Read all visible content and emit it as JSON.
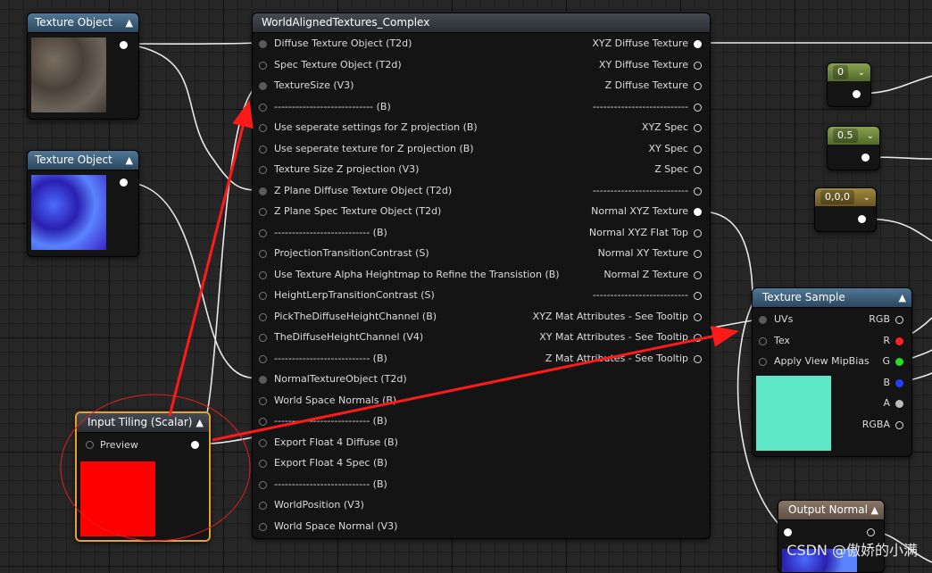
{
  "nodes": {
    "texture_object_1": {
      "title": "Texture Object"
    },
    "texture_object_2": {
      "title": "Texture Object"
    },
    "input_tiling": {
      "title": "Input Tiling (Scalar)",
      "pin": "Preview"
    },
    "world_aligned": {
      "title": "WorldAlignedTextures_Complex",
      "inputs": [
        "Diffuse Texture Object (T2d)",
        "Spec Texture Object (T2d)",
        "TextureSize (V3)",
        "---------------------------- (B)",
        "Use seperate settings for Z projection (B)",
        "Use seperate texture for Z projection (B)",
        "Texture Size Z projection (V3)",
        "Z Plane Diffuse Texture Object (T2d)",
        "Z Plane Spec Texture Object (T2d)",
        "---------------------------        (B)",
        "ProjectionTransitionContrast (S)",
        "Use Texture Alpha Heightmap to Refine the Transistion (B)",
        "HeightLerpTransitionContrast (S)",
        "PickTheDiffuseHeightChannel (B)",
        "TheDiffuseHeightChannel (V4)",
        "---------------------------        (B)",
        "NormalTextureObject (T2d)",
        "World Space Normals (B)",
        "---------------------------    (B)",
        "Export Float 4 Diffuse (B)",
        "Export Float 4 Spec (B)",
        "---------------------------        (B)",
        "WorldPosition (V3)",
        "World Space Normal (V3)"
      ],
      "outputs": [
        "XYZ Diffuse Texture",
        "XY Diffuse Texture",
        "Z Diffuse Texture",
        "---------------------------",
        "XYZ Spec",
        "XY Spec",
        "Z Spec",
        "---------------------------",
        "Normal XYZ Texture",
        "Normal XYZ Flat Top",
        "Normal XY Texture",
        "Normal Z Texture",
        "---------------------------",
        "XYZ Mat Attributes - See Tooltip",
        "XY Mat Attributes - See Tooltip",
        "Z Mat Attributes - See Tooltip"
      ]
    },
    "const_0": {
      "value": "0"
    },
    "const_05": {
      "value": "0.5"
    },
    "const_000": {
      "value": "0,0,0"
    },
    "texture_sample": {
      "title": "Texture Sample",
      "inputs": [
        "UVs",
        "Tex",
        "Apply View MipBias"
      ],
      "outputs": [
        "RGB",
        "R",
        "G",
        "B",
        "A",
        "RGBA"
      ]
    },
    "output_normal": {
      "title": "Output Normal"
    }
  },
  "colors": {
    "pin_r": "#ff2020",
    "pin_g": "#20e020",
    "pin_b": "#2040ff",
    "preview_scalar": "#ff0000",
    "preview_sample": "#5fe8c8",
    "annotation": "#ff1a1a",
    "input_tiling_selected": "#e8a030"
  },
  "watermark": "CSDN @傲娇的小满"
}
